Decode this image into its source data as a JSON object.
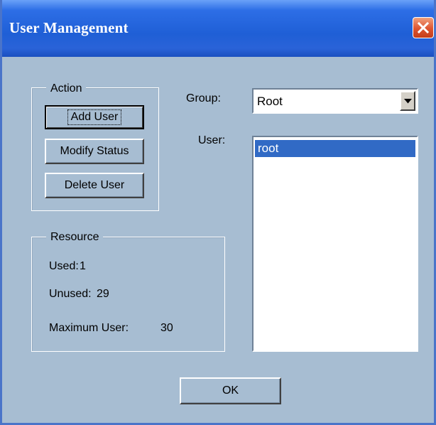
{
  "window": {
    "title": "User Management"
  },
  "action_group": {
    "legend": "Action",
    "buttons": {
      "add_user": "Add User",
      "modify_status": "Modify Status",
      "delete_user": "Delete User"
    }
  },
  "resource_group": {
    "legend": "Resource",
    "used_label": "Used:",
    "used_value": "1",
    "unused_label": "Unused:",
    "unused_value": "29",
    "maximum_label": "Maximum User:",
    "maximum_value": "30"
  },
  "group_field": {
    "label": "Group:",
    "selected": "Root"
  },
  "user_field": {
    "label": "User:",
    "items": [
      "root"
    ],
    "selected_index": 0
  },
  "footer": {
    "ok_label": "OK"
  },
  "icons": {
    "close": "close-icon",
    "dropdown": "chevron-down-icon"
  },
  "colors": {
    "title_bar": "#2d6ee6",
    "close_button": "#dd5430",
    "dialog_background": "#a7bdd2",
    "selection": "#316ac5"
  }
}
